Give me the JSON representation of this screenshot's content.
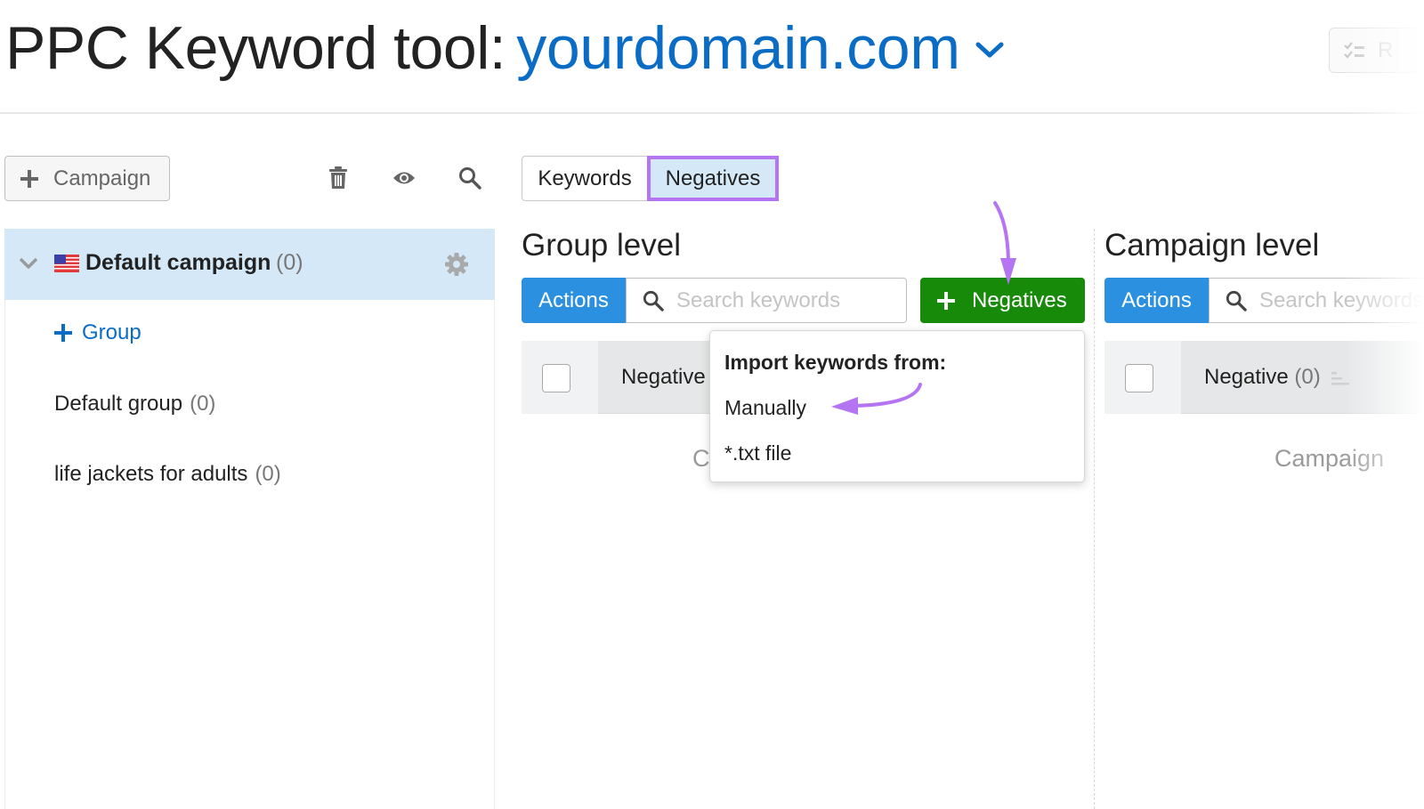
{
  "header": {
    "title_static": "PPC Keyword tool:",
    "domain": "yourdomain.com",
    "top_right_button_label": "R"
  },
  "sidebar": {
    "add_campaign_label": "Campaign",
    "toolbar_icons": [
      "trash-icon",
      "eye-icon",
      "search-icon"
    ],
    "campaign": {
      "name": "Default campaign",
      "count": "(0)",
      "flag": "us-flag"
    },
    "add_group_label": "Group",
    "groups": [
      {
        "name": "Default group",
        "count": "(0)"
      },
      {
        "name": "life jackets for adults",
        "count": "(0)"
      }
    ]
  },
  "tabs": [
    {
      "label": "Keywords",
      "active": false
    },
    {
      "label": "Negatives",
      "active": true
    }
  ],
  "group_level": {
    "title": "Group level",
    "actions_label": "Actions",
    "search_placeholder": "Search keywords",
    "add_negatives_label": "Negatives",
    "column_header": "Negative",
    "empty_text_partial": "C"
  },
  "campaign_level": {
    "title": "Campaign level",
    "actions_label": "Actions",
    "search_placeholder": "Search keywords",
    "column_header": "Negative",
    "column_count": "(0)",
    "empty_text_partial": "Campaign"
  },
  "import_dropdown": {
    "heading": "Import keywords from:",
    "items": [
      "Manually",
      "*.txt file"
    ]
  },
  "colors": {
    "brand_blue": "#0a6cc4",
    "actions_blue": "#2b90e0",
    "green_button": "#178a0a",
    "selected_bg": "#d4e8f7",
    "annotation_purple": "#b575f3"
  }
}
